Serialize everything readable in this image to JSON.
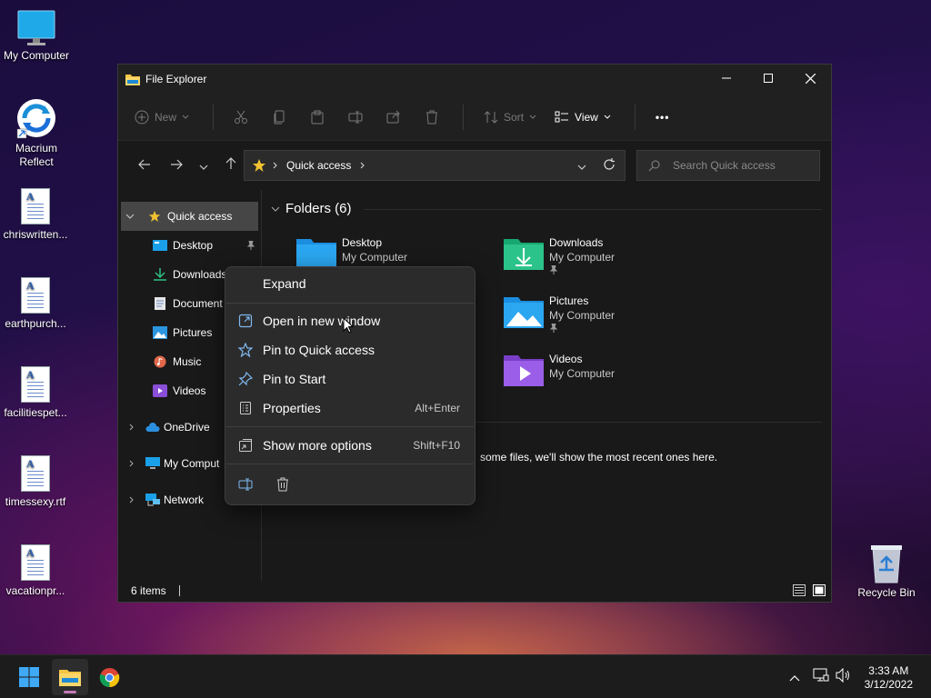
{
  "desktop": {
    "icons": [
      {
        "label": "My Computer"
      },
      {
        "label": "Macrium\nReflect"
      },
      {
        "label": "chriswritten..."
      },
      {
        "label": "earthpurch..."
      },
      {
        "label": "facilitiespet..."
      },
      {
        "label": "timessexy.rtf"
      },
      {
        "label": "vacationpr..."
      },
      {
        "label": "Recycle Bin"
      }
    ]
  },
  "window": {
    "title": "File Explorer",
    "toolbar": {
      "new_label": "New",
      "sort_label": "Sort",
      "view_label": "View",
      "more_label": "•••"
    },
    "address": {
      "path": "Quick access"
    },
    "search": {
      "placeholder": "Search Quick access"
    },
    "sidebar": {
      "items": [
        {
          "label": "Quick access"
        },
        {
          "label": "Desktop"
        },
        {
          "label": "Downloads"
        },
        {
          "label": "Document"
        },
        {
          "label": "Pictures"
        },
        {
          "label": "Music"
        },
        {
          "label": "Videos"
        },
        {
          "label": "OneDrive"
        },
        {
          "label": "My Comput"
        },
        {
          "label": "Network"
        }
      ]
    },
    "content": {
      "folders_header": "Folders (6)",
      "folders": [
        {
          "name": "Desktop",
          "location": "My Computer"
        },
        {
          "name": "Downloads",
          "location": "My Computer"
        },
        {
          "name": "Pictures",
          "location": "My Computer"
        },
        {
          "name": "Videos",
          "location": "My Computer"
        }
      ],
      "recent_message": "some files, we'll show the most recent ones here."
    },
    "status": {
      "items": "6 items"
    }
  },
  "context_menu": {
    "expand": "Expand",
    "open_new_window": "Open in new window",
    "pin_quick": "Pin to Quick access",
    "pin_start": "Pin to Start",
    "properties": "Properties",
    "properties_shortcut": "Alt+Enter",
    "show_more": "Show more options",
    "show_more_shortcut": "Shift+F10"
  },
  "taskbar": {
    "time": "3:33 AM",
    "date": "3/12/2022"
  },
  "colors": {
    "accent": "#0078d4",
    "folder_yellow": "#f5c542",
    "star": "#f2c230"
  }
}
